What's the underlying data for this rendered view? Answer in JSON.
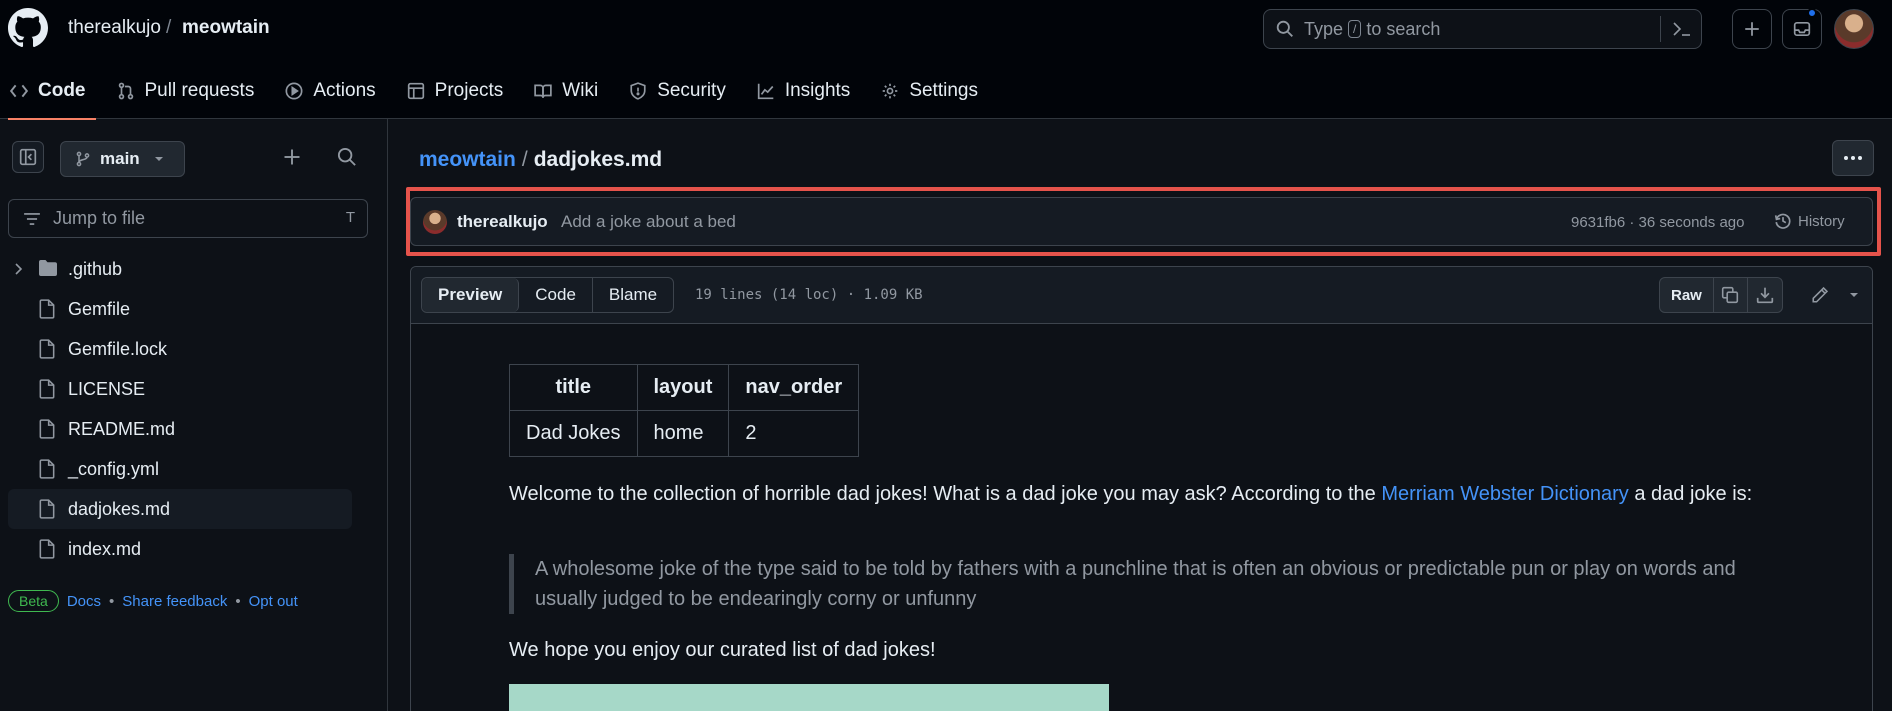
{
  "header": {
    "owner": "therealkujo",
    "separator": "/",
    "repo": "meowtain",
    "search_prefix": "Type",
    "search_key": "/",
    "search_suffix": "to search"
  },
  "tabs": [
    {
      "label": "Code",
      "icon": "code-icon",
      "active": true
    },
    {
      "label": "Pull requests",
      "icon": "pull-request-icon"
    },
    {
      "label": "Actions",
      "icon": "play-icon"
    },
    {
      "label": "Projects",
      "icon": "table-icon"
    },
    {
      "label": "Wiki",
      "icon": "book-icon"
    },
    {
      "label": "Security",
      "icon": "shield-icon"
    },
    {
      "label": "Insights",
      "icon": "graph-icon"
    },
    {
      "label": "Settings",
      "icon": "gear-icon"
    }
  ],
  "sidebar": {
    "branch": "main",
    "jump_placeholder": "Jump to file",
    "jump_key": "T",
    "files": [
      {
        "name": ".github",
        "type": "folder"
      },
      {
        "name": "Gemfile",
        "type": "file"
      },
      {
        "name": "Gemfile.lock",
        "type": "file"
      },
      {
        "name": "LICENSE",
        "type": "file"
      },
      {
        "name": "README.md",
        "type": "file"
      },
      {
        "name": "_config.yml",
        "type": "file"
      },
      {
        "name": "dadjokes.md",
        "type": "file",
        "selected": true
      },
      {
        "name": "index.md",
        "type": "file"
      }
    ],
    "beta_label": "Beta",
    "docs": "Docs",
    "dot": "•",
    "feedback": "Share feedback",
    "opt_out": "Opt out"
  },
  "main": {
    "repo_link": "meowtain",
    "crumb_sep": "/",
    "file_name": "dadjokes.md",
    "commit": {
      "author": "therealkujo",
      "message": "Add a joke about a bed",
      "meta": "9631fb6 · 36 seconds ago",
      "history": "History"
    },
    "view_tabs": [
      "Preview",
      "Code",
      "Blame"
    ],
    "file_info": "19 lines (14 loc) · 1.09 KB",
    "raw": "Raw",
    "frontmatter": {
      "headers": [
        "title",
        "layout",
        "nav_order"
      ],
      "row": [
        "Dad Jokes",
        "home",
        "2"
      ]
    },
    "intro_text": "Welcome to the collection of horrible dad jokes! What is a dad joke you may ask? According to the",
    "intro_link": "Merriam Webster Dictionary",
    "intro_after": "a dad joke is:",
    "quote": "A wholesome joke of the type said to be told by fathers with a punchline that is often an obvious or predictable pun or play on words and usually judged to be endearingly corny or unfunny",
    "closing": "We hope you enjoy our curated list of dad jokes!"
  },
  "colors": {
    "accent": "#4493f8",
    "tab_underline": "#f78166",
    "highlight": "#e5534b",
    "beta": "#3fb950"
  }
}
